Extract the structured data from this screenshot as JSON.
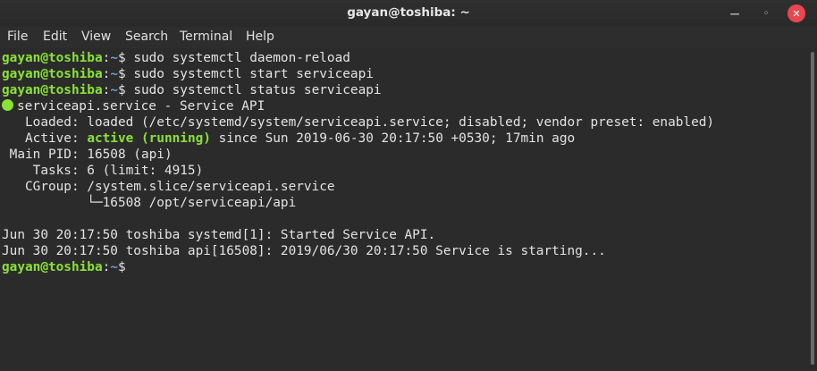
{
  "window": {
    "title": "gayan@toshiba: ~",
    "min_symbol": "—",
    "max_symbol": "◦",
    "close_symbol": "✕"
  },
  "menu": {
    "items": [
      "File",
      "Edit",
      "View",
      "Search",
      "Terminal",
      "Help"
    ]
  },
  "terminal": {
    "user_host": "gayan@toshiba",
    "colon": ":",
    "path": "~",
    "prompt_char": "$ ",
    "commands": [
      "sudo systemctl daemon-reload",
      "sudo systemctl start serviceapi",
      "sudo systemctl status serviceapi"
    ],
    "service_line": "serviceapi.service - Service API",
    "loaded_line": "   Loaded: loaded (/etc/systemd/system/serviceapi.service; disabled; vendor preset: enabled)",
    "active_label": "   Active: ",
    "active_state": "active (running)",
    "active_rest": " since Sun 2019-06-30 20:17:50 +0530; 17min ago",
    "main_pid_line": " Main PID: 16508 (api)",
    "tasks_line": "    Tasks: 6 (limit: 4915)",
    "cgroup_line": "   CGroup: /system.slice/serviceapi.service",
    "cgroup_child_line": "           └─16508 /opt/serviceapi/api",
    "log_lines": [
      "Jun 30 20:17:50 toshiba systemd[1]: Started Service API.",
      "Jun 30 20:17:50 toshiba api[16508]: 2019/06/30 20:17:50 Service is starting..."
    ]
  },
  "colors": {
    "prompt_green": "#8ae234",
    "path_blue": "#729fcf",
    "background": "#2b2b2b",
    "close_red": "#e9474f"
  }
}
